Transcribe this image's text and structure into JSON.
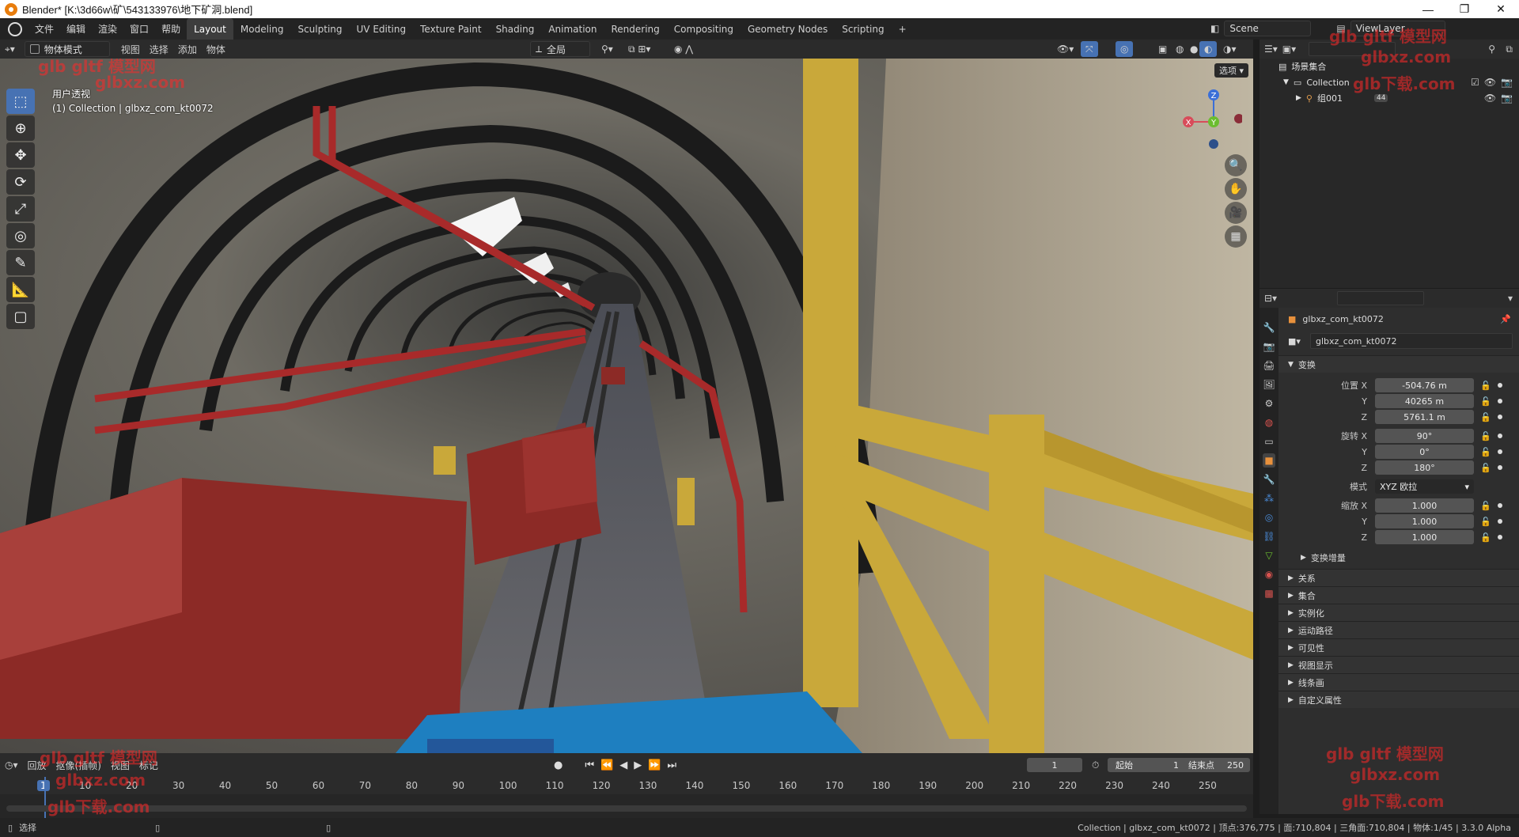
{
  "titlebar": {
    "title": "Blender* [K:\\3d66w\\矿\\543133976\\地下矿洞.blend]",
    "min": "—",
    "max": "❐",
    "close": "✕"
  },
  "menubar": {
    "menus": [
      "文件",
      "编辑",
      "渲染",
      "窗口",
      "帮助"
    ],
    "workspaces": [
      "Layout",
      "Modeling",
      "Sculpting",
      "UV Editing",
      "Texture Paint",
      "Shading",
      "Animation",
      "Rendering",
      "Compositing",
      "Geometry Nodes",
      "Scripting"
    ],
    "active_workspace": "Layout",
    "add_tab": "+",
    "scene": "Scene",
    "view_layer": "ViewLayer"
  },
  "viewport_header": {
    "mode": "物体模式",
    "menus": [
      "视图",
      "选择",
      "添加",
      "物体"
    ],
    "transform_orientation": "全局",
    "options": "选项"
  },
  "viewport": {
    "perspective_label": "用户透视",
    "collection_label": "(1) Collection | glbxz_com_kt0072",
    "gizmo": {
      "x": "X",
      "y": "Y",
      "z": "Z"
    },
    "colors": {
      "rock": "#6d6a62",
      "red_cart": "#8c2a26",
      "yellow_rail": "#c9a83a",
      "floor_blue": "#1e7fc0",
      "pipe_red": "#a82a2a"
    }
  },
  "tools": [
    "select-box",
    "cursor",
    "move",
    "rotate",
    "scale",
    "transform",
    "annotate",
    "measure",
    "add-cube"
  ],
  "outliner": {
    "scene_collection": "场景集合",
    "collection": "Collection",
    "object": "组001",
    "object_badge": "44"
  },
  "properties": {
    "object_name_header": "glbxz_com_kt0072",
    "object_name_field": "glbxz_com_kt0072",
    "transform_section": "变换",
    "location_label": "位置 X",
    "rotation_label": "旋转 X",
    "scale_label": "缩放 X",
    "mode_label": "模式",
    "y_label": "Y",
    "z_label": "Z",
    "location": {
      "x": "-504.76 m",
      "y": "40265 m",
      "z": "5761.1 m"
    },
    "rotation": {
      "x": "90°",
      "y": "0°",
      "z": "180°"
    },
    "rotation_mode": "XYZ 欧拉",
    "scale": {
      "x": "1.000",
      "y": "1.000",
      "z": "1.000"
    },
    "delta_transform": "变换增量",
    "sections": [
      "关系",
      "集合",
      "实例化",
      "运动路径",
      "可见性",
      "视图显示",
      "线条画",
      "自定义属性"
    ]
  },
  "timeline": {
    "menus": [
      "回放",
      "抠像(插帧)",
      "视图",
      "标记"
    ],
    "current_frame": "1",
    "start_label": "起始",
    "start": "1",
    "end_label": "结束点",
    "end": "250",
    "ticks": [
      "1",
      "10",
      "20",
      "30",
      "40",
      "50",
      "60",
      "70",
      "80",
      "90",
      "100",
      "110",
      "120",
      "130",
      "140",
      "150",
      "160",
      "170",
      "180",
      "190",
      "200",
      "210",
      "220",
      "230",
      "240",
      "250"
    ]
  },
  "statusbar": {
    "left": "选择",
    "right": "Collection | glbxz_com_kt0072 | 顶点:376,775 | 面:710,804 | 三角面:710,804 | 物体:1/45 | 3.3.0 Alpha"
  },
  "watermarks": [
    "glb gltf 模型网",
    "glbxz.com",
    "glb下载.com"
  ]
}
